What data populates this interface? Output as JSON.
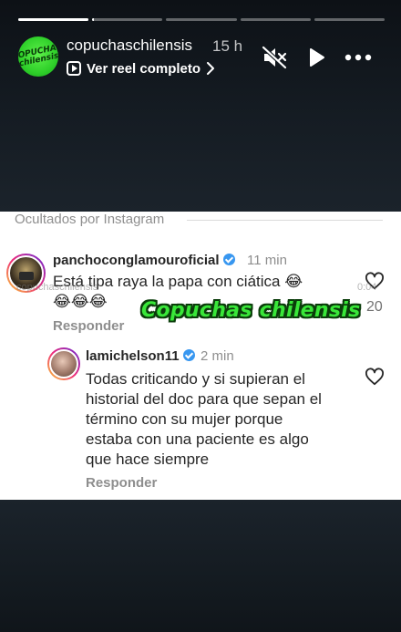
{
  "story": {
    "progress_segments": [
      {
        "fill": 1.0
      },
      {
        "fill": 0.02
      },
      {
        "fill": 0
      },
      {
        "fill": 0
      },
      {
        "fill": 0
      }
    ],
    "account": "copuchaschilensis",
    "avatar_text": "COPUCHAS chilensis",
    "time_ago": "15 h",
    "reel_link": "Ver reel completo",
    "icons": [
      "muted-speaker-icon",
      "play-icon",
      "more-icon"
    ]
  },
  "comments_panel": {
    "hidden_label": "Ocultados por Instagram",
    "watermark_left": "copuchaschilensis",
    "watermark_right": "0:04",
    "overlay_brand": "Copuchas chilensis",
    "comment": {
      "username": "panchoconglamouroficial",
      "verified": true,
      "time": "11 min",
      "text_line1": "Está tipa raya la papa con ciática 😂",
      "text_line2": "😂😂😂",
      "reply_label": "Responder",
      "likes": "20"
    },
    "reply": {
      "username": "lamichelson11",
      "verified": true,
      "time": "2 min",
      "lines": [
        "Todas criticando y si supieran el",
        "historial del doc para que sepan el",
        "término con su mujer porque",
        "estaba con una paciente es algo",
        "que hace siempre"
      ],
      "reply_label": "Responder"
    }
  },
  "colors": {
    "accent_verified": "#3897f0",
    "brand_green": "#39e639"
  }
}
